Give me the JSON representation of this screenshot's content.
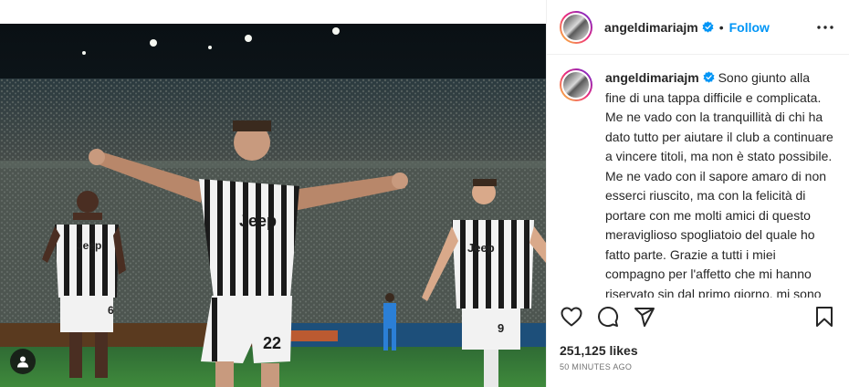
{
  "post": {
    "username": "angeldimariajm",
    "separator": "•",
    "follow_label": "Follow",
    "caption": "Sono giunto alla fine di una tappa difficile e complicata. Me ne vado con la tranquillità di chi ha dato tutto per aiutare il club a continuare a vincere titoli, ma non è stato possibile. Me ne vado con il sapore amaro di non esserci riuscito, ma con la felicità di portare con me molti amici di questo meraviglioso spogliatoio del quale ho fatto parte. Grazie a tutti i miei compagno per l'affetto che mi hanno riservato sin dal primo giorno, mi sono sempre sentito",
    "likes": "251,125 likes",
    "time_ago": "50 MINUTES AGO"
  },
  "photo": {
    "jersey_sponsor": "Jeep",
    "number_left": "6",
    "number_center": "22",
    "number_right": "9"
  },
  "icons": {
    "verified": "verified-badge-icon",
    "more": "more-options-icon",
    "like": "heart-icon",
    "comment": "comment-icon",
    "share": "share-icon",
    "save": "bookmark-icon",
    "tag": "user-tag-icon"
  },
  "colors": {
    "accent": "#0095f6",
    "text": "#262626",
    "muted": "#737373"
  }
}
